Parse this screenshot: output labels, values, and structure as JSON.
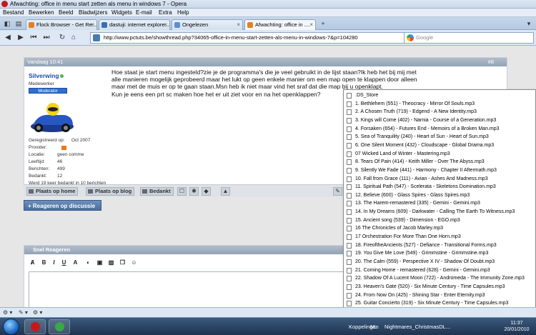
{
  "window": {
    "title": "Afwachting: office in menu start zetten als menu in windows 7 - Opera"
  },
  "menu": [
    "Bestand",
    "Bewerken",
    "Beeld",
    "Bladwijzers",
    "Widgets",
    "E-mail",
    "Extra",
    "Help"
  ],
  "tabs": [
    {
      "label": "Flock Browser - Get Re..."
    },
    {
      "label": "dastuji: internet explore..."
    },
    {
      "label": "Ongelezen"
    },
    {
      "label": "Afwachting: office in ...."
    }
  ],
  "address": {
    "url": "http://www.pctuts.be/showthread.php?34065-office-in-menu-start-zetten-als-menu-in-windows-7&p=104280",
    "search_placeholder": "Google"
  },
  "post": {
    "date": "Vandaag 10:41",
    "number": "#8",
    "username": "Silverwing",
    "usertitle": "Medewerker",
    "badge": "Moderator",
    "info": [
      {
        "label": "Geregistreerd op:",
        "value": "Oct 2007"
      },
      {
        "label": "Provider:",
        "value": ""
      },
      {
        "label": "Locatie:",
        "value": "geen comme"
      },
      {
        "label": "Leeftijd:",
        "value": "46"
      },
      {
        "label": "Berichten:",
        "value": "499"
      },
      {
        "label": "Bedankt:",
        "value": "12"
      }
    ],
    "thanks_line": "Werd 19 keer bedankt in 10 berichten",
    "text": "Hoe staat je start menu ingesteld?zie je de programma's die je veel gebruikt in de lijst staan?Ik heb het bij mij met alle manieren mogelijk geprobeerd maar het lukt op geen enkele manier om een map open te klappen door alleen maar met de muis er op te gaan staan.Msn heb ik niet maar vind het sraf dat die map bij u openklapt.\nKun je eens een prt sc maken hoe het er uit ziet voor en na het openklappen?"
  },
  "post_buttons": {
    "home": "Plaats op home",
    "blog": "Plaats op blog",
    "thanks": "Bedankt"
  },
  "reply_button": "+ Reageren op discussie",
  "quick_reply": {
    "title": "Snel Reageren"
  },
  "file_list": [
    ".DS_Store",
    "1. Bethlehem (551) - Theocracy - Mirror Of Souls.mp3",
    "2. A Chosen Truth (719) - Edgend - A New Identity.mp3",
    "3. Kings will Come (402) - Narnia - Course of a Generation.mp3",
    "4. Forsaken (654) - Futures End - Memoirs of a Broken Man.mp3",
    "5. Sea of Tranquility (240) - Heart of Sun - Heart of Sun.mp3",
    "6. One Silent Moment (432) - Cloudscape - Global Drama.mp3",
    "07 Wicked Land of Winter - Mastering.mp3",
    "8. Tears Of Pain (414) - Keith Miller - Over The Abyss.mp3",
    "9. Silently We Fade (441) - Harmony - Chapter II Aftermath.mp3",
    "10. Fall from Grace (111) - Avian - Ashes And Madness.mp3",
    "11. Spiritual Path (547) - Scelerata - Skeletons Domination.mp3",
    "12. Believe (600) - Glass Spires - Glass Spires.mp3",
    "13. The Harem-remastered (335) - Gemini - Gemini.mp3",
    "14. In My Dreams (609) - Darkwater - Calling The Earth To Witness.mp3",
    "15. Ancient song (539) - Dimension - EGO.mp3",
    "16 The Chronicles of Jacob Marley.mp3",
    "17 Orchestration For More Than One Horn.mp3",
    "18. FireoftheAncients (527) - Defiance - Transitional Forms.mp3",
    "19. You Give Me Love (549) - Grimmstine - Grimmstine.mp3",
    "20. The Calm (559) - Perspective X IV - Shadow Of Doubt.mp3",
    "21. Coming Home - remastered (628) - Gemini - Gemini.mp3",
    "22. Shadow Of A Lucent Moon (722) - Andromeda - The Immunity Zone.mp3",
    "23. Heaven's Gate (520) - Six Minute Century - Time Capsules.mp3",
    "24. From Now On (425) - Shining Star - Enter Eternity.mp3",
    "25. Guitar Concierto (319) - Six Minute Century - Time Capsules.mp3",
    "nummers.rtf"
  ],
  "taskbar": {
    "label1": "Koppelingen",
    "label2": "NL",
    "label3": "Nightmares_ChristmasDL...",
    "time": "11:37",
    "date": "20/01/2010"
  },
  "colors": {
    "link": "#1a4fa8",
    "header": "#93a3b6",
    "online": "#56b44c",
    "badge": "#2e6fd0"
  }
}
